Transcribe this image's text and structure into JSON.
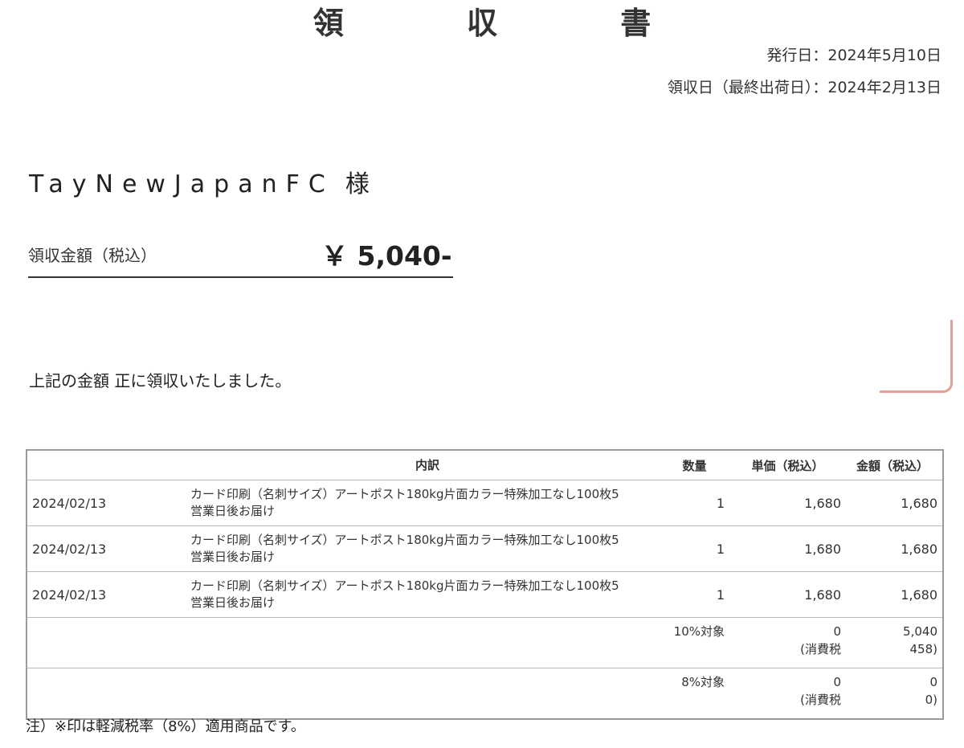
{
  "header": {
    "title": "領 収 書",
    "issue_date": "発行日：2024年5月10日",
    "receipt_date": "領収日（最終出荷日）：2024年2月13日"
  },
  "recipient": {
    "name": "TayNewJapanFC",
    "honorific": "様"
  },
  "amount": {
    "label": "領収金額（税込）",
    "value": "￥ 5,040-"
  },
  "received_text": "上記の金額 正に領収いたしました。",
  "table": {
    "headers": {
      "description": "内訳",
      "quantity": "数量",
      "unit_price": "単価（税込）",
      "amount": "金額（税込）"
    },
    "rows": [
      {
        "date": "2024/02/13",
        "description_line1": "カード印刷（名刺サイズ）アートポスト180kg片面カラー特殊加工なし100枚5",
        "description_line2": "営業日後お届け",
        "quantity": "1",
        "unit_price": "1,680",
        "amount": "1,680"
      },
      {
        "date": "2024/02/13",
        "description_line1": "カード印刷（名刺サイズ）アートポスト180kg片面カラー特殊加工なし100枚5",
        "description_line2": "営業日後お届け",
        "quantity": "1",
        "unit_price": "1,680",
        "amount": "1,680"
      },
      {
        "date": "2024/02/13",
        "description_line1": "カード印刷（名刺サイズ）アートポスト180kg片面カラー特殊加工なし100枚5",
        "description_line2": "営業日後お届け",
        "quantity": "1",
        "unit_price": "1,680",
        "amount": "1,680"
      }
    ],
    "tax_rows": [
      {
        "label": "10%対象",
        "base": "0",
        "tax_label": "(消費税",
        "amount": "5,040",
        "tax_amount": "458)"
      },
      {
        "label": "8%対象",
        "base": "0",
        "tax_label": "(消費税",
        "amount": "0",
        "tax_amount": "0)"
      }
    ]
  },
  "note": "注）※印は軽減税率（8%）適用商品です。",
  "colors": {
    "stamp": "#e08f85",
    "border": "#9a9a9a"
  }
}
